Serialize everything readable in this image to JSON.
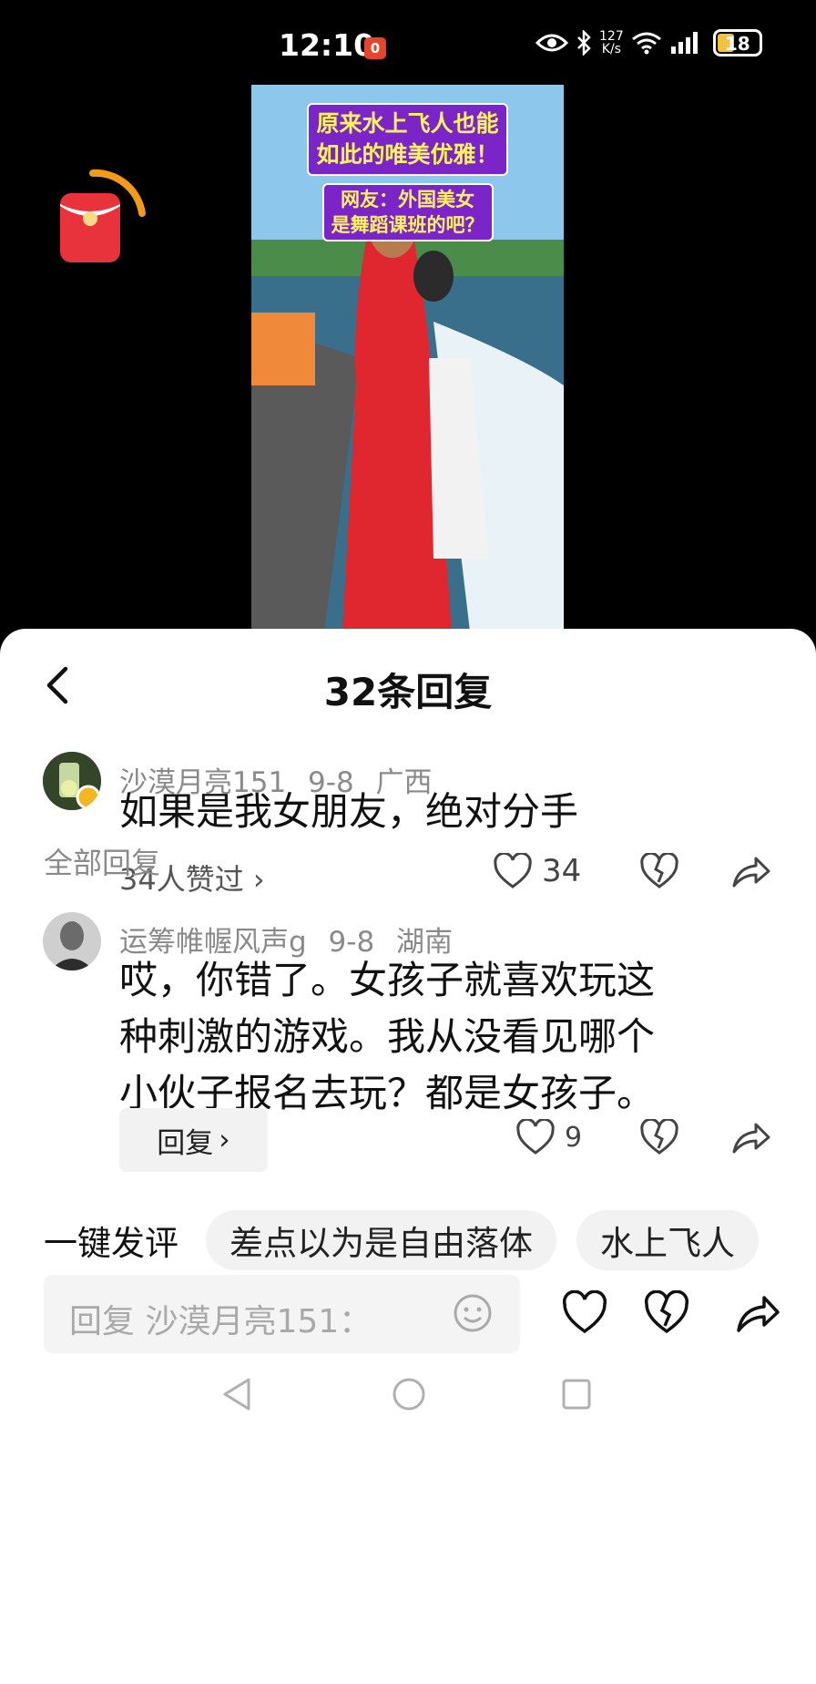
{
  "status_bar": {
    "time": "12:10",
    "record_badge": "0",
    "net_speed_value": "127",
    "net_speed_unit": "K/s",
    "battery": "18"
  },
  "video": {
    "caption_line1": "原来水上飞人也能",
    "caption_line2": "如此的唯美优雅！",
    "caption_line3": "网友：外国美女",
    "caption_line4": "是舞蹈课班的吧？"
  },
  "sheet": {
    "title": "32条回复"
  },
  "main_comment": {
    "username": "沙漠月亮151",
    "date": "9-8",
    "location": "广西",
    "text": "如果是我女朋友，绝对分手",
    "likers_text": "34人赞过",
    "like_count": "34"
  },
  "section_label": "全部回复",
  "reply": {
    "username": "运筹帷幄风声g",
    "date": "9-8",
    "location": "湖南",
    "text_line1": "哎，你错了。女孩子就喜欢玩这",
    "text_line2": "种刺激的游戏。我从没看见哪个",
    "text_line3": "小伙子报名去玩？都是女孩子。",
    "reply_button": "回复",
    "like_count": "9"
  },
  "quick_comments": {
    "label": "一键发评",
    "chips": [
      "差点以为是自由落体",
      "水上飞人"
    ]
  },
  "input": {
    "placeholder": "回复 沙漠月亮151："
  },
  "colors": {
    "accent_red": "#e5452d",
    "caption_purple": "#7b25c8",
    "caption_yellow": "#fff45c",
    "meta_gray": "#8a8a8a"
  }
}
